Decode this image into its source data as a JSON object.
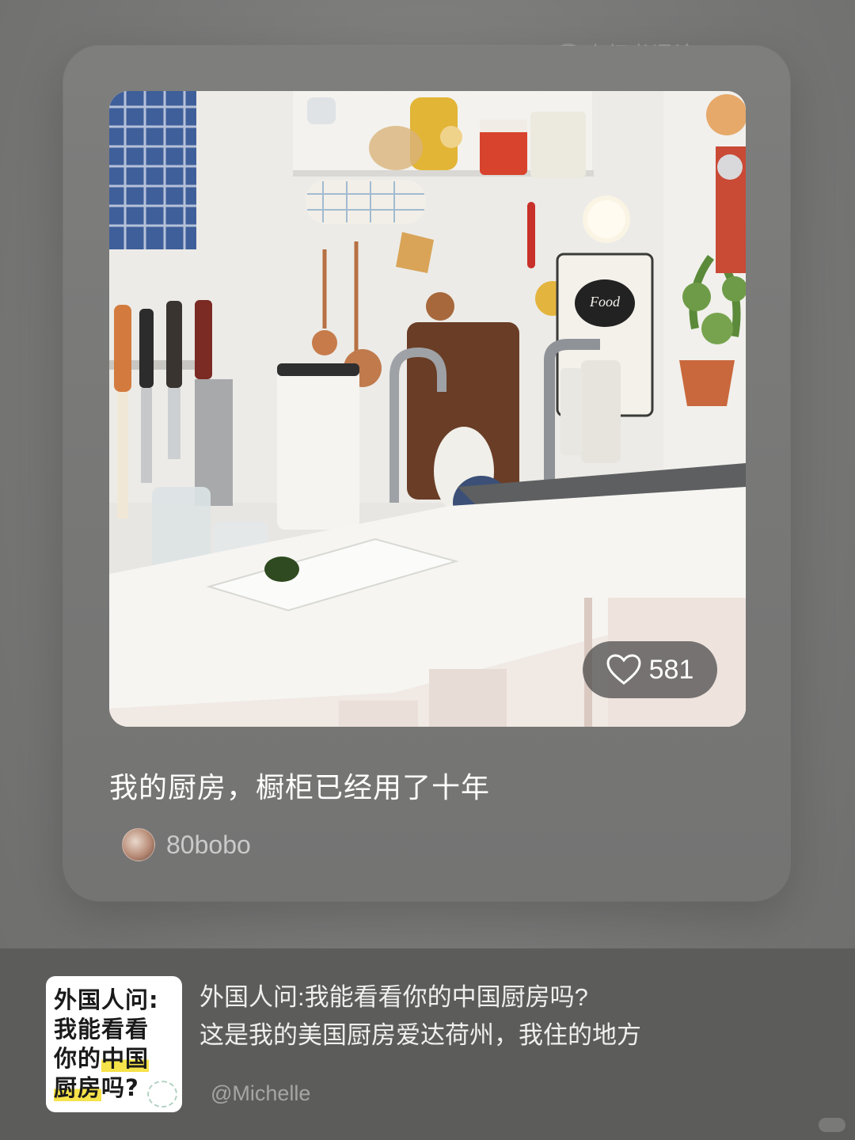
{
  "watermark": {
    "text": "小红书评论"
  },
  "post": {
    "title": "我的厨房，橱柜已经用了十年",
    "likes": "581",
    "author": "80bobo"
  },
  "bottom": {
    "thumbnail_lines": [
      "外国人问:",
      "我能看看",
      "你的",
      "中国",
      "厨房",
      "吗?"
    ],
    "description_line1": "外国人问:我能看看你的中国厨房吗?",
    "description_line2": "这是我的美国厨房爱达荷州，我住的地方",
    "handle": "@Michelle"
  }
}
